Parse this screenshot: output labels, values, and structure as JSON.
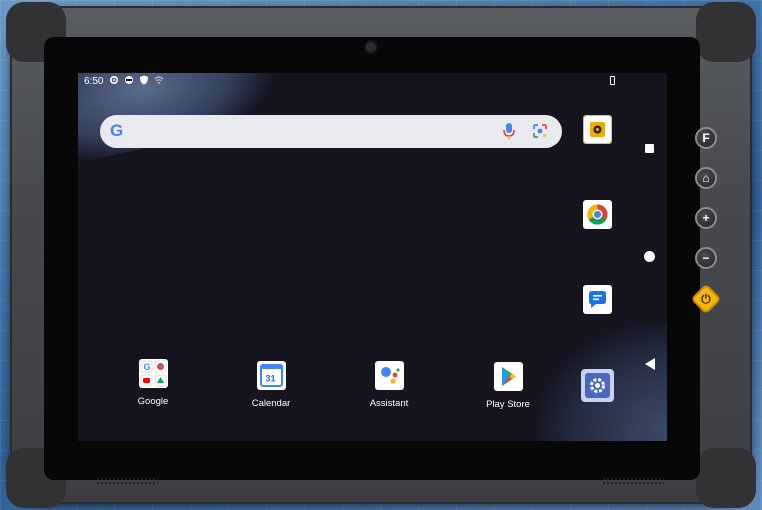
{
  "status_bar": {
    "time": "6:50",
    "icons": [
      "gear-icon",
      "sync-icon",
      "shield-icon",
      "wifi-off-icon"
    ],
    "battery": "battery-icon"
  },
  "search": {
    "logo": "G",
    "mic": "mic-icon",
    "lens": "lens-icon"
  },
  "dock_apps": [
    {
      "label": "Google"
    },
    {
      "label": "Calendar",
      "badge": "31"
    },
    {
      "label": "Assistant"
    },
    {
      "label": "Play Store"
    }
  ],
  "side_apps": [
    "camera-app-icon",
    "chrome-icon",
    "messages-icon",
    "settings-icon"
  ],
  "nav": [
    "overview-icon",
    "home-icon",
    "back-icon"
  ],
  "hardware_buttons": [
    {
      "label": "F"
    },
    {
      "label": "⌂"
    },
    {
      "label": "+"
    },
    {
      "label": "−"
    },
    {
      "label": "⏻"
    }
  ],
  "colors": {
    "power_button": "#f3b70e",
    "screen_bg": "#15141f"
  }
}
